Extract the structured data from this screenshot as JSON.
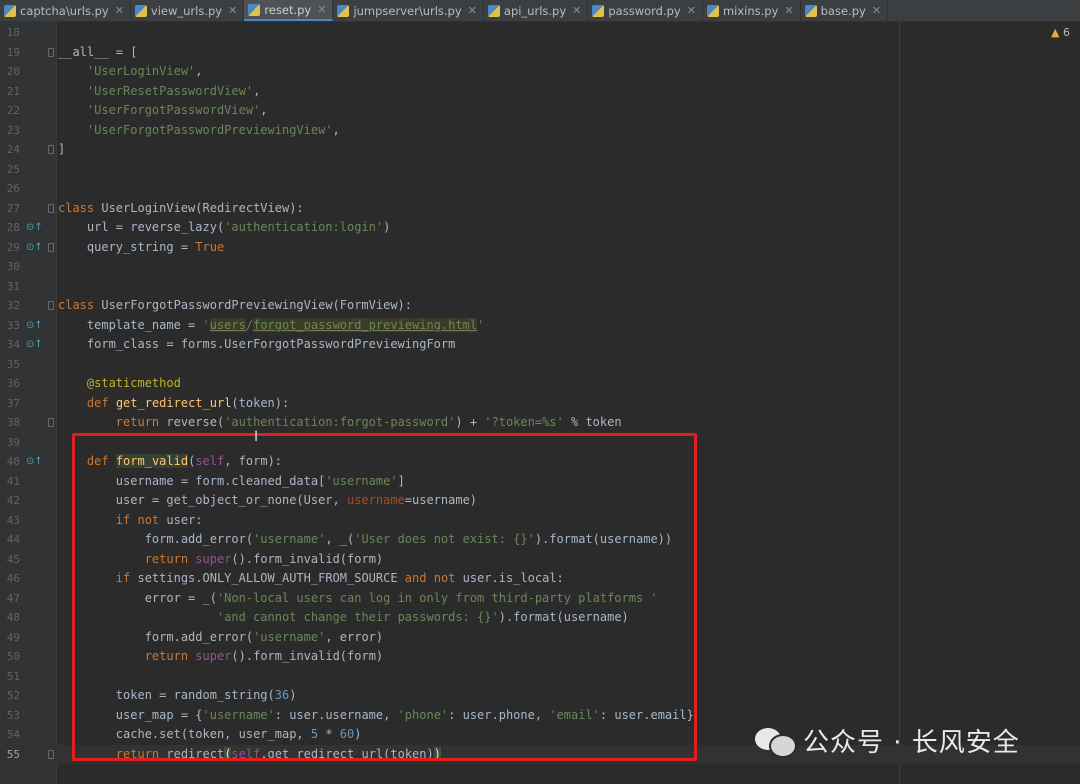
{
  "tabs": [
    {
      "label": "captcha\\urls.py",
      "active": false
    },
    {
      "label": "view_urls.py",
      "active": false
    },
    {
      "label": "reset.py",
      "active": true
    },
    {
      "label": "jumpserver\\urls.py",
      "active": false
    },
    {
      "label": "api_urls.py",
      "active": false
    },
    {
      "label": "password.py",
      "active": false
    },
    {
      "label": "mixins.py",
      "active": false
    },
    {
      "label": "base.py",
      "active": false
    }
  ],
  "editor": {
    "warning_count": "6",
    "current_line": 55
  },
  "code_lines": [
    {
      "n": "18",
      "html": ""
    },
    {
      "n": "19",
      "html": "__all__ = ["
    },
    {
      "n": "20",
      "html": "    'UserLoginView',"
    },
    {
      "n": "21",
      "html": "    'UserResetPasswordView',"
    },
    {
      "n": "22",
      "html": "    'UserForgotPasswordView',"
    },
    {
      "n": "23",
      "html": "    'UserForgotPasswordPreviewingView',"
    },
    {
      "n": "24",
      "html": "]"
    },
    {
      "n": "25",
      "html": ""
    },
    {
      "n": "26",
      "html": ""
    },
    {
      "n": "27",
      "html": "class UserLoginView(RedirectView):"
    },
    {
      "n": "28",
      "html": "    url = reverse_lazy('authentication:login')"
    },
    {
      "n": "29",
      "html": "    query_string = True"
    },
    {
      "n": "30",
      "html": ""
    },
    {
      "n": "31",
      "html": ""
    },
    {
      "n": "32",
      "html": "class UserForgotPasswordPreviewingView(FormView):"
    },
    {
      "n": "33",
      "html": "    template_name = 'users/forgot_password_previewing.html'"
    },
    {
      "n": "34",
      "html": "    form_class = forms.UserForgotPasswordPreviewingForm"
    },
    {
      "n": "35",
      "html": ""
    },
    {
      "n": "36",
      "html": "    @staticmethod"
    },
    {
      "n": "37",
      "html": "    def get_redirect_url(token):"
    },
    {
      "n": "38",
      "html": "        return reverse('authentication:forgot-password') + '?token=%s' % token"
    },
    {
      "n": "39",
      "html": ""
    },
    {
      "n": "40",
      "html": "    def form_valid(self, form):"
    },
    {
      "n": "41",
      "html": "        username = form.cleaned_data['username']"
    },
    {
      "n": "42",
      "html": "        user = get_object_or_none(User, username=username)"
    },
    {
      "n": "43",
      "html": "        if not user:"
    },
    {
      "n": "44",
      "html": "            form.add_error('username', _('User does not exist: {}').format(username))"
    },
    {
      "n": "45",
      "html": "            return super().form_invalid(form)"
    },
    {
      "n": "46",
      "html": "        if settings.ONLY_ALLOW_AUTH_FROM_SOURCE and not user.is_local:"
    },
    {
      "n": "47",
      "html": "            error = _('Non-local users can log in only from third-party platforms '"
    },
    {
      "n": "48",
      "html": "                      'and cannot change their passwords: {}').format(username)"
    },
    {
      "n": "49",
      "html": "            form.add_error('username', error)"
    },
    {
      "n": "50",
      "html": "            return super().form_invalid(form)"
    },
    {
      "n": "51",
      "html": ""
    },
    {
      "n": "52",
      "html": "        token = random_string(36)"
    },
    {
      "n": "53",
      "html": "        user_map = {'username': user.username, 'phone': user.phone, 'email': user.email}"
    },
    {
      "n": "54",
      "html": "        cache.set(token, user_map, 5 * 60)"
    },
    {
      "n": "55",
      "html": "        return redirect(self.get_redirect_url(token))"
    }
  ],
  "watermark": {
    "text": "公众号 · 长风安全"
  },
  "colors": {
    "background": "#2b2b2b",
    "annotation_box": "#e02020",
    "keyword": "#cc7832",
    "string": "#6a8759"
  }
}
